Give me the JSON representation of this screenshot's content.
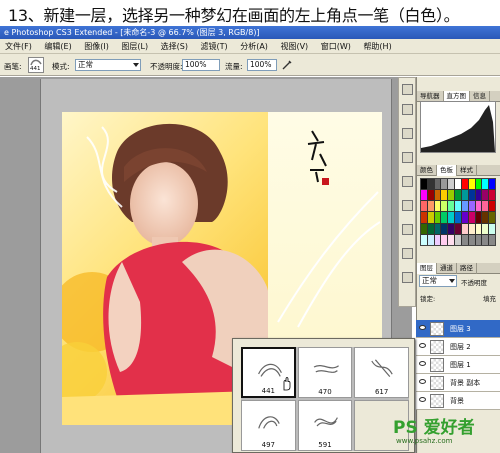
{
  "instruction": "13、新建一层，选择另一种梦幻在画面的左上角点一笔（白色）。",
  "window_title": "e Photoshop CS3 Extended - [未命名-3 @ 66.7% (图层 3, RGB/8)]",
  "menu": [
    "文件(F)",
    "编辑(E)",
    "图像(I)",
    "图层(L)",
    "选择(S)",
    "滤镜(T)",
    "分析(A)",
    "视图(V)",
    "窗口(W)",
    "帮助(H)"
  ],
  "options": {
    "brush_label": "画笔:",
    "brush_size": "441",
    "mode_label": "模式:",
    "mode_value": "正常",
    "opacity_label": "不透明度:",
    "opacity_value": "100%",
    "flow_label": "流量:",
    "flow_value": "100%"
  },
  "panels": {
    "top_tabs": [
      "导航器",
      "直方图",
      "信息"
    ],
    "color_tabs": [
      "颜色",
      "色板",
      "样式"
    ],
    "layer_tabs": [
      "图层",
      "通道",
      "路径"
    ],
    "blend_mode": "正常",
    "opacity_label": "不透明度",
    "lock_label": "锁定:",
    "fill_label": "填充"
  },
  "layers": [
    {
      "name": "图层 3",
      "active": true
    },
    {
      "name": "图层 2",
      "active": false
    },
    {
      "name": "图层 1",
      "active": false
    },
    {
      "name": "背景 副本",
      "active": false
    },
    {
      "name": "背景",
      "active": false
    }
  ],
  "brushes": [
    {
      "size": "441",
      "selected": true
    },
    {
      "size": "470",
      "selected": false
    },
    {
      "size": "617",
      "selected": false
    },
    {
      "size": "497",
      "selected": false
    },
    {
      "size": "591",
      "selected": false
    }
  ],
  "watermark": "PS 爱好者",
  "watermark_url": "www.psahz.com",
  "colors": {
    "title_bar": "#2a58b8",
    "selection": "#3169c6",
    "dress": "#e2304a"
  }
}
